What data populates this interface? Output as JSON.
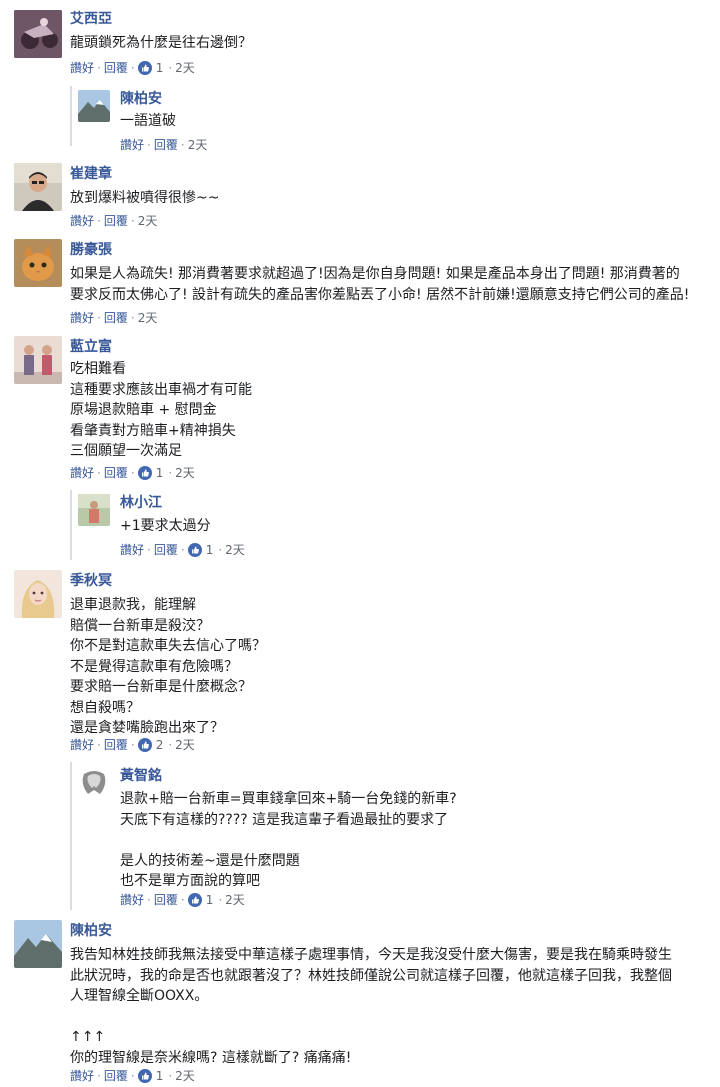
{
  "labels": {
    "like": "讚好",
    "reply": "回覆",
    "dot": "·"
  },
  "comments": [
    {
      "name": "艾西亞",
      "lines": "龍頭鎖死為什麼是往右邊倒？",
      "likes": "1",
      "time": "2天"
    },
    {
      "name": "陳柏安",
      "lines": "一語道破",
      "likes": "",
      "time": "2天"
    },
    {
      "name": "崔建章",
      "lines": "放到爆料被噴得很慘~~",
      "likes": "",
      "time": "2天"
    },
    {
      "name": "勝豪張",
      "lines": "如果是人為疏失! 那消費著要求就超過了!因為是你自身問題! 如果是產品本身出了問題! 那消費著的\n要求反而太佛心了! 設計有疏失的產品害你差點丟了小命! 居然不計前嫌!還願意支持它們公司的產品!",
      "likes": "",
      "time": "2天"
    },
    {
      "name": "藍立富",
      "lines": "吃相難看\n這種要求應該出車禍才有可能\n原場退款賠車 + 慰問金\n看肇責對方賠車+精神損失\n三個願望一次滿足",
      "likes": "1",
      "time": "2天"
    },
    {
      "name": "林小江",
      "lines": "+1要求太過分",
      "likes": "1",
      "time": "2天"
    },
    {
      "name": "季秋冥",
      "lines": "退車退款我，能理解\n賠償一台新車是殺洨？\n你不是對這款車失去信心了嗎？\n不是覺得這款車有危險嗎？\n要求賠一台新車是什麼概念？\n想自殺嗎？\n還是貪婪嘴臉跑出來了？",
      "likes": "2",
      "time": "2天"
    },
    {
      "name": "黃智銘",
      "lines": "退款+賠一台新車=買車錢拿回來+騎一台免錢的新車?\n天底下有這樣的???? 這是我這輩子看過最扯的要求了\n\n是人的技術差~還是什麼問題\n也不是單方面說的算吧",
      "likes": "1",
      "time": "2天"
    },
    {
      "name": "陳柏安",
      "lines": "我告知林姓技師我無法接受中華這樣子處理事情，今天是我沒受什麼大傷害，要是我在騎乘時發生\n此狀況時，我的命是否也就跟著沒了？林姓技師僅說公司就這樣子回覆，他就這樣子回我，我整個\n人理智線全斷OOXX。\n\n↑↑↑\n你的理智線是奈米線嗎? 這樣就斷了? 痛痛痛!",
      "likes": "1",
      "time": "2天"
    }
  ]
}
